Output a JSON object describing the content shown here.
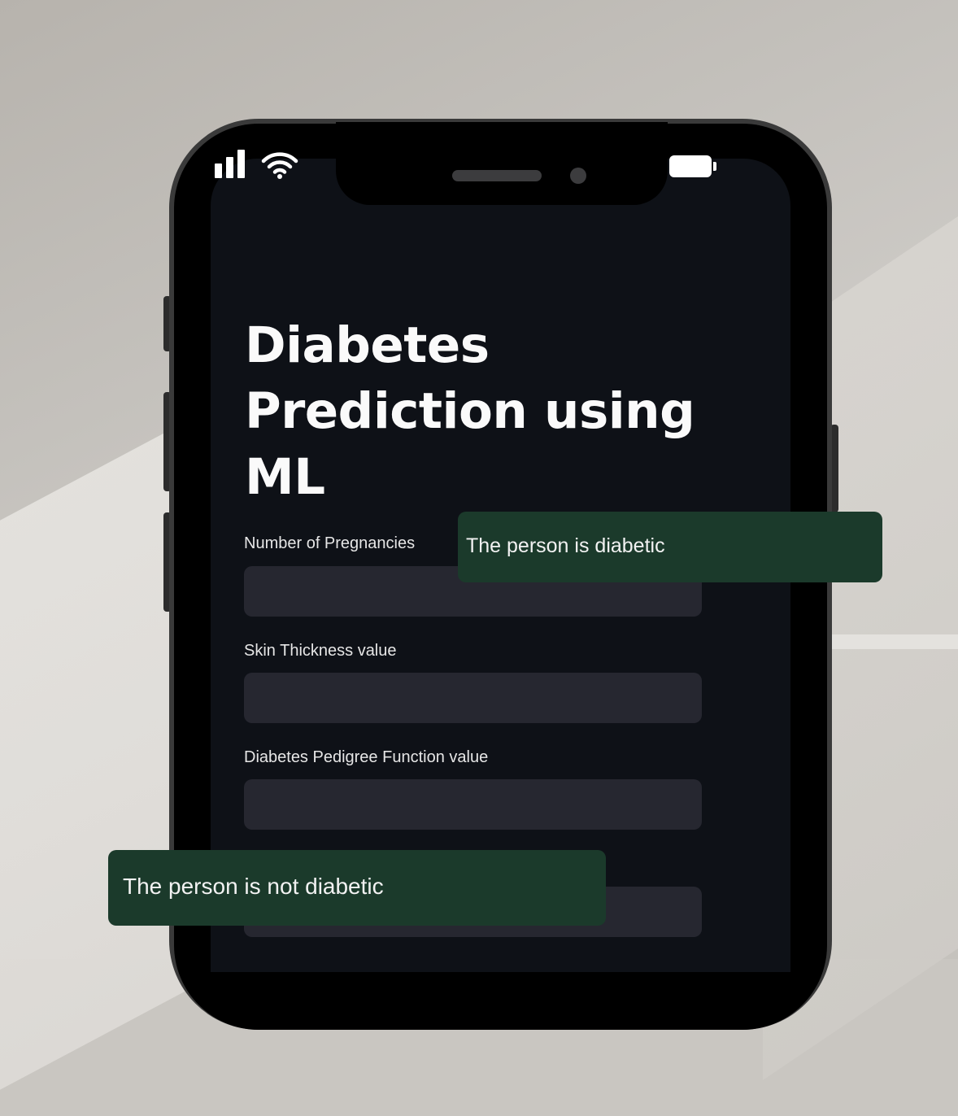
{
  "app": {
    "title": "Diabetes Prediction using ML"
  },
  "status_bar": {
    "icons": [
      "signal-icon",
      "wifi-icon",
      "battery-icon"
    ]
  },
  "form": {
    "fields": [
      {
        "label": "Number of Pregnancies",
        "value": ""
      },
      {
        "label": "Skin Thickness value",
        "value": ""
      },
      {
        "label": "Diabetes Pedigree Function value",
        "value": ""
      },
      {
        "label": "",
        "value": ""
      }
    ]
  },
  "results": {
    "positive": "The person is diabetic",
    "negative": "The person is not diabetic"
  },
  "colors": {
    "screen_bg": "#0e1117",
    "input_bg": "#262730",
    "result_bg": "#1b3a2b",
    "text": "#fafafa"
  }
}
